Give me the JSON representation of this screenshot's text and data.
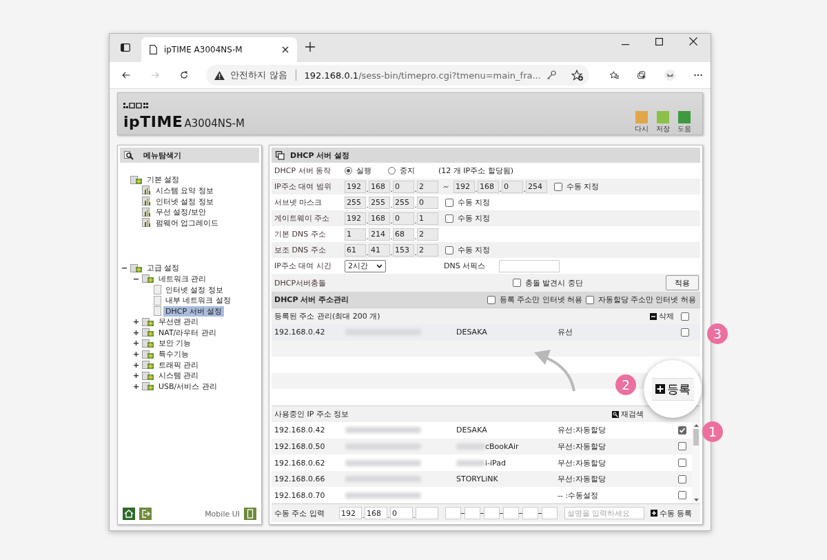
{
  "browser": {
    "tab_title": "ipTIME A3004NS-M",
    "security_label": "안전하지 않음",
    "url_host": "192.168.0.1",
    "url_path": "/sess-bin/timepro.cgi?tmenu=main_fra..."
  },
  "header": {
    "brand": "ipTIME",
    "model": "A3004NS-M",
    "actions": [
      {
        "label": "다시",
        "color": "#e2a64a"
      },
      {
        "label": "저장",
        "color": "#8cc04a"
      },
      {
        "label": "도움",
        "color": "#3f9a3f"
      }
    ]
  },
  "sidebar": {
    "title": "메뉴탐색기",
    "tree": [
      {
        "label": "기본 설정",
        "kind": "section",
        "selected": false,
        "children": [
          {
            "label": "시스템 요약 정보",
            "kind": "page",
            "selected": false
          },
          {
            "label": "인터넷 설정 정보",
            "kind": "page",
            "selected": false
          },
          {
            "label": "무선 설정/보안",
            "kind": "page",
            "selected": false
          },
          {
            "label": "펌웨어 업그레이드",
            "kind": "page",
            "selected": false
          }
        ]
      },
      {
        "label": "고급 설정",
        "kind": "folder",
        "expanded": true,
        "selected": false,
        "children": [
          {
            "label": "네트워크 관리",
            "kind": "folder",
            "expanded": true,
            "selected": false,
            "children": [
              {
                "label": "인터넷 설정 정보",
                "kind": "leaf",
                "selected": false
              },
              {
                "label": "내부 네트워크 설정",
                "kind": "leaf",
                "selected": false
              },
              {
                "label": "DHCP 서버 설정",
                "kind": "leaf",
                "selected": true
              }
            ]
          },
          {
            "label": "무선랜 관리",
            "kind": "folder",
            "expanded": false,
            "selected": false
          },
          {
            "label": "NAT/라우터 관리",
            "kind": "folder",
            "expanded": false,
            "selected": false
          },
          {
            "label": "보안 기능",
            "kind": "folder",
            "expanded": false,
            "selected": false
          },
          {
            "label": "특수기능",
            "kind": "folder",
            "expanded": false,
            "selected": false
          },
          {
            "label": "트래픽 관리",
            "kind": "folder",
            "expanded": false,
            "selected": false
          },
          {
            "label": "시스템 관리",
            "kind": "folder",
            "expanded": false,
            "selected": false
          },
          {
            "label": "USB/서비스 관리",
            "kind": "folder",
            "expanded": false,
            "selected": false
          }
        ]
      }
    ],
    "footer_label": "Mobile UI"
  },
  "panel": {
    "title": "DHCP 서버 설정",
    "ip_separator": ".",
    "server_mode": {
      "label": "DHCP 서버 동작",
      "options": [
        {
          "label": "실행",
          "selected": true
        },
        {
          "label": "중지",
          "selected": false
        }
      ],
      "note": "(12 개 IP주소 할당됨)"
    },
    "address_rows": [
      {
        "kind": "range",
        "label": "IP주소 대여 범위",
        "start": [
          "192",
          "168",
          "0",
          "2"
        ],
        "end": [
          "192",
          "168",
          "0",
          "254"
        ],
        "manual": {
          "label": "수동 지정",
          "checked": false
        }
      },
      {
        "kind": "ip",
        "label": "서브넷 마스크",
        "start": [
          "255",
          "255",
          "255",
          "0"
        ],
        "manual": {
          "label": "수동 지정",
          "checked": false
        }
      },
      {
        "kind": "ip",
        "label": "게이트웨이 주소",
        "start": [
          "192",
          "168",
          "0",
          "1"
        ],
        "manual": {
          "label": "수동 지정",
          "checked": false
        }
      },
      {
        "kind": "ip",
        "label": "기본 DNS 주소",
        "start": [
          "1",
          "214",
          "68",
          "2"
        ]
      },
      {
        "kind": "ip",
        "label": "보조 DNS 주소",
        "start": [
          "61",
          "41",
          "153",
          "2"
        ],
        "manual": {
          "label": "수동 지정",
          "checked": false
        }
      }
    ],
    "lease": {
      "label": "IP주소 대여 시간",
      "value": "2시간",
      "suffix_label": "DNS 서픽스"
    },
    "conflict": {
      "label": "DHCP서버충돌",
      "option": {
        "label": "충돌 발견시 중단",
        "checked": false
      },
      "apply": "적용"
    },
    "address_management": {
      "title": "DHCP 서버 주소관리",
      "options": [
        {
          "label": "등록 주소만 인터넷 허용",
          "checked": false
        },
        {
          "label": "자동할당 주소만 인터넷 허용",
          "checked": false
        }
      ]
    },
    "registered": {
      "title": "등록된 주소 관리(최대 200 개)",
      "delete": "삭제",
      "all_checked": false,
      "rows": [
        {
          "ip": "192.168.0.42",
          "name": "DESAKA",
          "type": "유선",
          "checked": false
        }
      ]
    },
    "in_use": {
      "title": "사용중인 IP 주소 정보",
      "rescan": "재검색",
      "rows": [
        {
          "ip": "192.168.0.42",
          "name": "DESAKA",
          "name_blurred": false,
          "type": "유선:자동할당",
          "checked": true
        },
        {
          "ip": "192.168.0.50",
          "name": "cBookAir",
          "name_blurred": true,
          "type": "무선:자동할당",
          "checked": false
        },
        {
          "ip": "192.168.0.62",
          "name": "i-iPad",
          "name_blurred": true,
          "type": "무선:자동할당",
          "checked": false
        },
        {
          "ip": "192.168.0.66",
          "name": "STORYLiNK",
          "name_blurred": false,
          "type": "무선:자동할당",
          "checked": false
        },
        {
          "ip": "192.168.0.70",
          "name_blurred": false,
          "type": "-- :수동설정",
          "checked": false
        }
      ]
    },
    "manual_entry": {
      "label": "수동 주소 입력",
      "ip": [
        "192",
        "168",
        "0"
      ],
      "placeholder": "설명을 입력하세요",
      "button": "수동 등록"
    }
  },
  "overlay": {
    "lens_button": "등록",
    "callouts": [
      "1",
      "2",
      "3"
    ]
  }
}
